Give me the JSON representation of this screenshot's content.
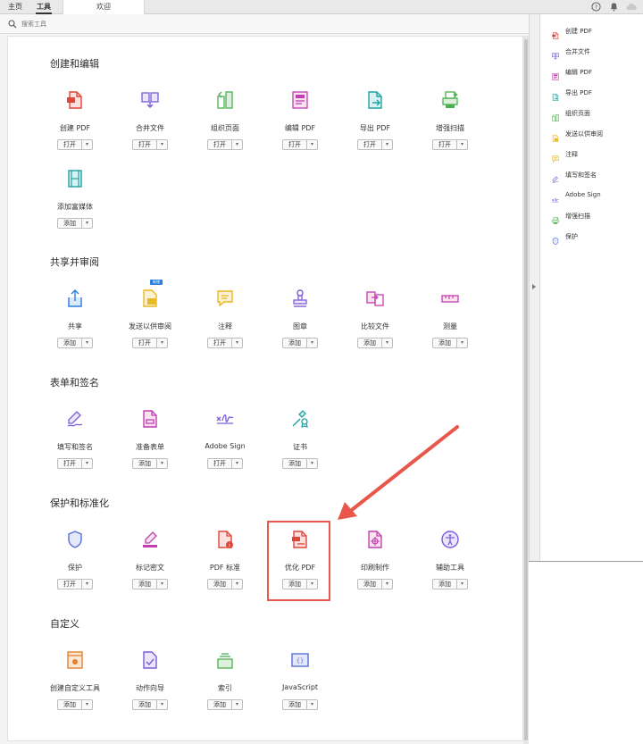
{
  "tabs": {
    "home": "主页",
    "tools": "工具",
    "document": "欢迎"
  },
  "search": {
    "placeholder": "搜索工具"
  },
  "sections": [
    {
      "title": "创建和编辑",
      "tools": [
        {
          "label": "创建 PDF",
          "button": "打开",
          "icon": "create-pdf-icon"
        },
        {
          "label": "合并文件",
          "button": "打开",
          "icon": "combine-files-icon"
        },
        {
          "label": "组织页面",
          "button": "打开",
          "icon": "organize-pages-icon"
        },
        {
          "label": "编辑 PDF",
          "button": "打开",
          "icon": "edit-pdf-icon"
        },
        {
          "label": "导出 PDF",
          "button": "打开",
          "icon": "export-pdf-icon"
        },
        {
          "label": "增强扫描",
          "button": "打开",
          "icon": "enhance-scan-icon"
        },
        {
          "label": "添加富媒体",
          "button": "添加",
          "icon": "rich-media-icon"
        }
      ]
    },
    {
      "title": "共享并审阅",
      "tools": [
        {
          "label": "共享",
          "button": "添加",
          "icon": "share-icon"
        },
        {
          "label": "发送以供审阅",
          "button": "打开",
          "icon": "send-for-review-icon",
          "badge": "新增"
        },
        {
          "label": "注释",
          "button": "打开",
          "icon": "comment-icon"
        },
        {
          "label": "图章",
          "button": "添加",
          "icon": "stamp-icon"
        },
        {
          "label": "比较文件",
          "button": "添加",
          "icon": "compare-files-icon"
        },
        {
          "label": "测量",
          "button": "添加",
          "icon": "measure-icon"
        }
      ]
    },
    {
      "title": "表单和签名",
      "tools": [
        {
          "label": "填写和签名",
          "button": "打开",
          "icon": "fill-sign-icon"
        },
        {
          "label": "准备表单",
          "button": "添加",
          "icon": "prepare-form-icon"
        },
        {
          "label": "Adobe Sign",
          "button": "打开",
          "icon": "adobe-sign-icon"
        },
        {
          "label": "证书",
          "button": "添加",
          "icon": "certificate-icon"
        }
      ]
    },
    {
      "title": "保护和标准化",
      "tools": [
        {
          "label": "保护",
          "button": "打开",
          "icon": "protect-icon"
        },
        {
          "label": "标记密文",
          "button": "添加",
          "icon": "redact-icon"
        },
        {
          "label": "PDF 标准",
          "button": "添加",
          "icon": "pdf-standards-icon"
        },
        {
          "label": "优化 PDF",
          "button": "添加",
          "icon": "optimize-pdf-icon"
        },
        {
          "label": "印刷制作",
          "button": "添加",
          "icon": "print-production-icon"
        },
        {
          "label": "辅助工具",
          "button": "添加",
          "icon": "accessibility-icon"
        }
      ]
    },
    {
      "title": "自定义",
      "tools": [
        {
          "label": "创建自定义工具",
          "button": "添加",
          "icon": "custom-tool-icon"
        },
        {
          "label": "动作向导",
          "button": "添加",
          "icon": "action-wizard-icon"
        },
        {
          "label": "索引",
          "button": "添加",
          "icon": "index-icon"
        },
        {
          "label": "JavaScript",
          "button": "添加",
          "icon": "javascript-icon"
        }
      ]
    }
  ],
  "right_panel": [
    {
      "label": "创建 PDF",
      "icon": "create-pdf-icon"
    },
    {
      "label": "合并文件",
      "icon": "combine-files-icon"
    },
    {
      "label": "编辑 PDF",
      "icon": "edit-pdf-icon"
    },
    {
      "label": "导出 PDF",
      "icon": "export-pdf-icon"
    },
    {
      "label": "组织页面",
      "icon": "organize-pages-icon"
    },
    {
      "label": "发送以供审阅",
      "icon": "send-for-review-icon"
    },
    {
      "label": "注释",
      "icon": "comment-icon"
    },
    {
      "label": "填写和签名",
      "icon": "fill-sign-icon"
    },
    {
      "label": "Adobe Sign",
      "icon": "adobe-sign-icon"
    },
    {
      "label": "增强扫描",
      "icon": "enhance-scan-icon"
    },
    {
      "label": "保护",
      "icon": "protect-icon"
    }
  ],
  "colors": {
    "highlight": "#e8574a",
    "red": "#e0453a",
    "purple": "#7b5cd6",
    "green": "#4caf50",
    "teal": "#1fa3a3",
    "blue": "#2a7de1",
    "yellow": "#e8b923",
    "magenta": "#c23fb3",
    "orange": "#e8802a"
  }
}
